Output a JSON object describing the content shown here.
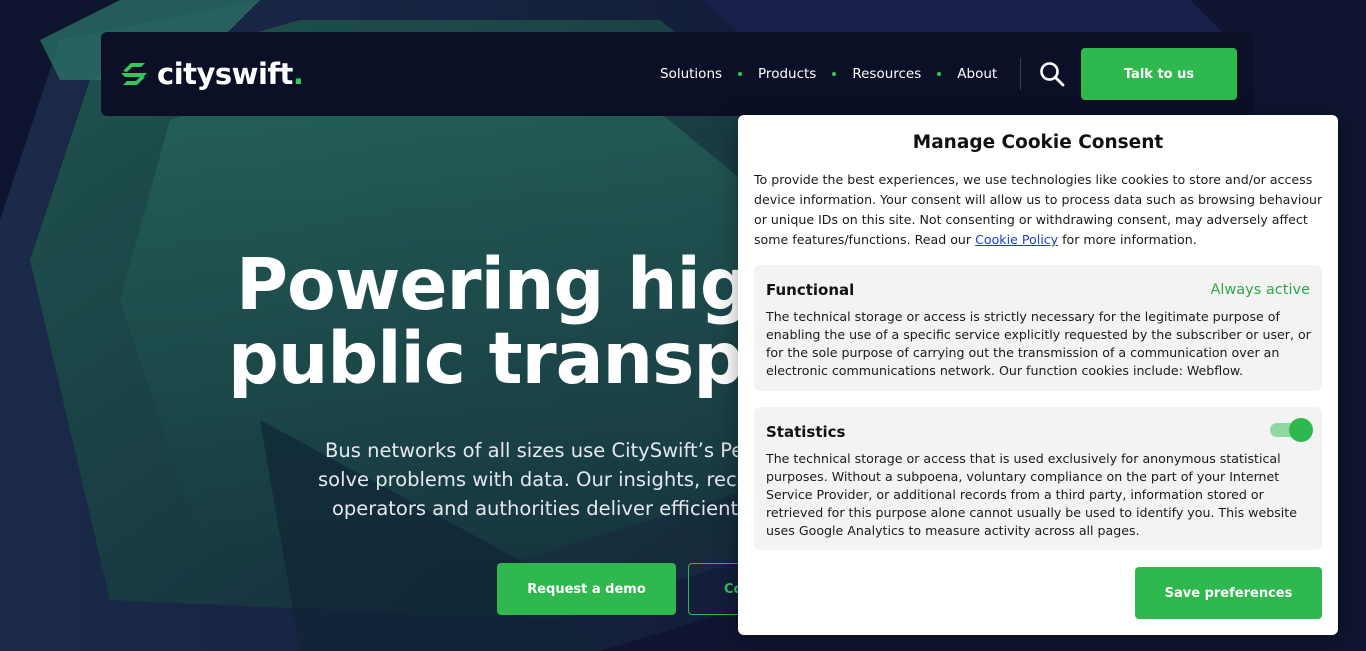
{
  "brand": {
    "name": "cityswift",
    "dot": ".",
    "accent": "#34c759",
    "button_green": "#2fb84d",
    "nav_bg": "#0b1026",
    "page_bg": "#0f1530"
  },
  "nav": {
    "links": [
      "Solutions",
      "Products",
      "Resources",
      "About"
    ],
    "search_icon": "search-icon",
    "cta_label": "Talk to us"
  },
  "hero": {
    "title_line1": "Powering high",
    "title_line2": "public transpor",
    "subtitle_line1": "Bus networks of all sizes use CitySwift’s Perfor",
    "subtitle_line2": "solve problems with data. Our insights, recomm",
    "subtitle_line3": "operators and authorities deliver efficient, re",
    "primary_cta": "Request a demo",
    "secondary_cta": "Co"
  },
  "cookie": {
    "title": "Manage Cookie Consent",
    "intro_text": "To provide the best experiences, we use technologies like cookies to store and/or access device information. Your consent will allow us to process data such as browsing behaviour or unique IDs on this site. Not consenting or withdrawing consent, may adversely affect some features/functions. Read our ",
    "policy_link": "Cookie Policy",
    "intro_suffix": " for more information.",
    "categories": [
      {
        "title": "Functional",
        "status": "Always active",
        "description": "The technical storage or access is strictly necessary for the legitimate purpose of enabling the use of a specific service explicitly requested by the subscriber or user, or for the sole purpose of carrying out the transmission of a communication over an electronic communications network. Our function cookies include: Webflow."
      },
      {
        "title": "Statistics",
        "toggle_on": true,
        "description": "The technical storage or access that is used exclusively for anonymous statistical purposes. Without a subpoena, voluntary compliance on the part of your Internet Service Provider, or additional records from a third party, information stored or retrieved for this purpose alone cannot usually be used to identify you. This website uses Google Analytics to measure activity across all pages."
      }
    ],
    "save_label": "Save preferences"
  }
}
